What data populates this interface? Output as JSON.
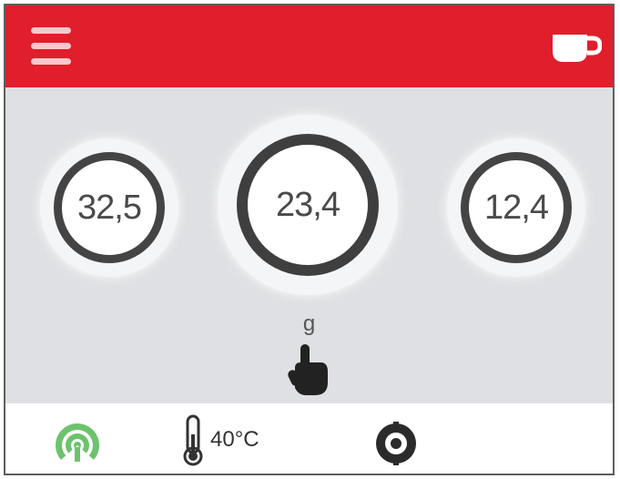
{
  "header": {
    "menu_icon": "hamburger-menu-icon",
    "cup_icon": "coffee-cup-icon"
  },
  "gauges": [
    {
      "id": "left",
      "value": "32,5"
    },
    {
      "id": "center",
      "value": "23,4"
    },
    {
      "id": "right",
      "value": "12,4"
    }
  ],
  "unit": "g",
  "footer": {
    "wifi_icon": "wireless-signal-icon",
    "thermometer_icon": "thermometer-icon",
    "temperature": "40°C",
    "grind_icon": "grind-knob-icon"
  },
  "colors": {
    "header": "#e01e2c",
    "background": "#dfe0e3",
    "ring": "#444444",
    "wifi": "#6cc36c"
  }
}
